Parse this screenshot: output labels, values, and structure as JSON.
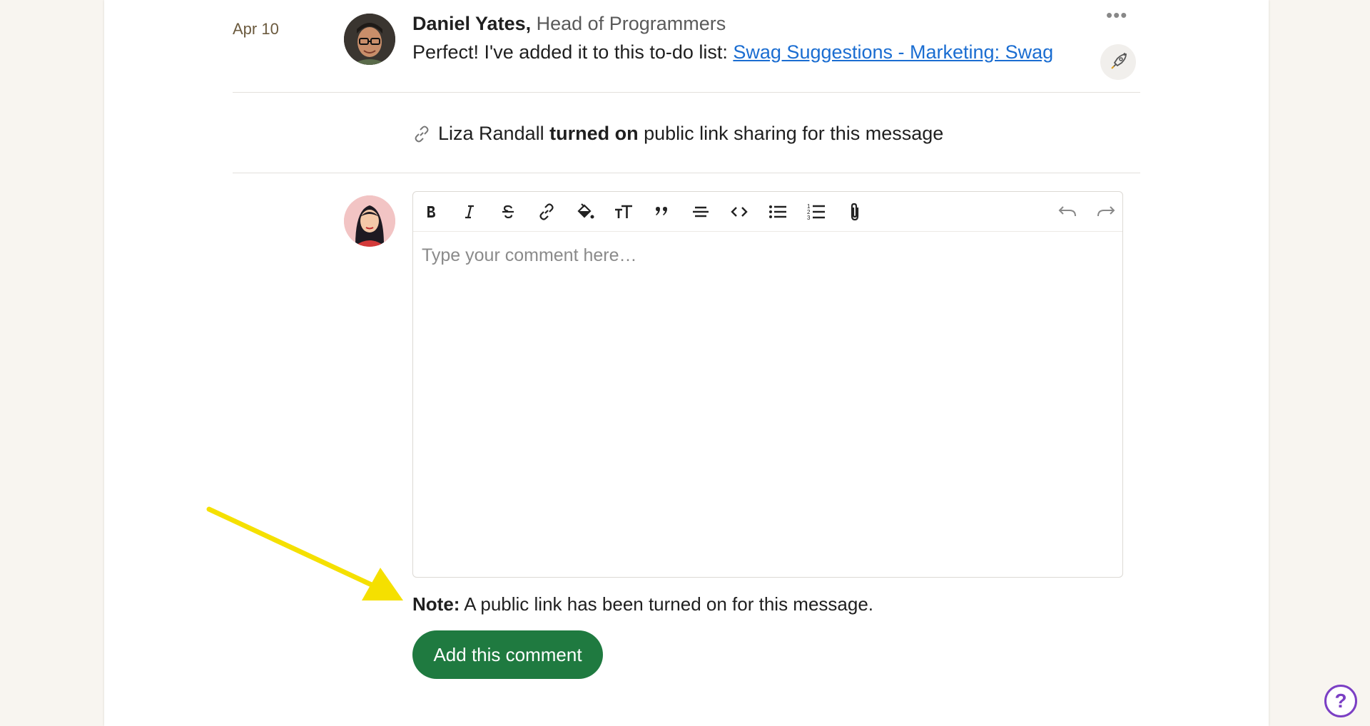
{
  "message": {
    "date": "Apr 10",
    "author_name": "Daniel Yates,",
    "author_role": "Head of Programmers",
    "body_text": "Perfect! I've added it to this to-do list: ",
    "link_text": "Swag Suggestions - Marketing: Swag",
    "more_label": "•••"
  },
  "event": {
    "actor": "Liza Randall",
    "action": "turned on",
    "rest": "public link sharing for this message"
  },
  "editor": {
    "placeholder": "Type your comment here…",
    "value": "",
    "toolbar": [
      "bold-icon",
      "italic-icon",
      "strikethrough-icon",
      "link-icon",
      "highlight-icon",
      "text-size-icon",
      "quote-icon",
      "horizontal-rule-icon",
      "code-icon",
      "bulleted-list-icon",
      "numbered-list-icon",
      "attachment-icon",
      "undo-icon",
      "redo-icon"
    ]
  },
  "note": {
    "label": "Note:",
    "text": " A public link has been turned on for this message."
  },
  "submit_label": "Add this comment",
  "help_label": "?",
  "colors": {
    "accent_green": "#1f7a40",
    "link_blue": "#1a6dd1",
    "help_purple": "#7b3fc4",
    "annotation_yellow": "#f5e000"
  }
}
